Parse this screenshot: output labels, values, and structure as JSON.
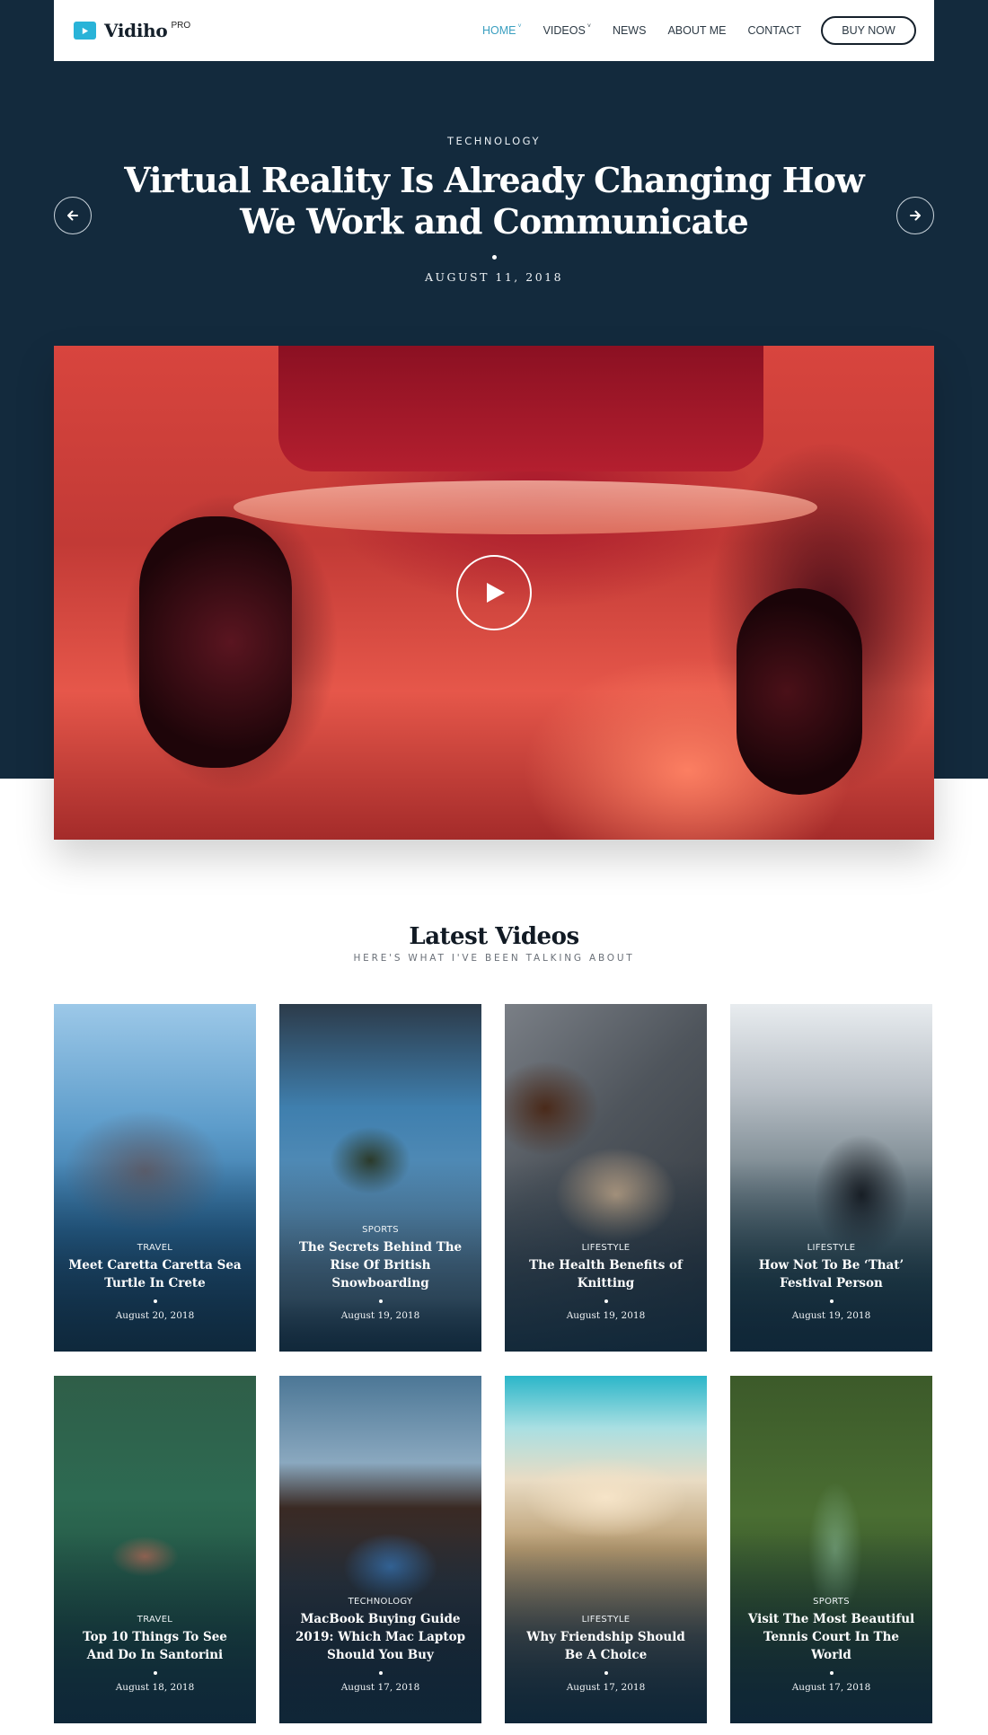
{
  "header": {
    "brand": "Vidiho",
    "brand_badge": "PRO",
    "nav": [
      {
        "label": "HOME",
        "has_dropdown": true,
        "active": true
      },
      {
        "label": "VIDEOS",
        "has_dropdown": true,
        "active": false
      },
      {
        "label": "NEWS",
        "has_dropdown": false,
        "active": false
      },
      {
        "label": "ABOUT ME",
        "has_dropdown": false,
        "active": false
      },
      {
        "label": "CONTACT",
        "has_dropdown": false,
        "active": false
      }
    ],
    "caret": "˅",
    "cta_label": "BUY NOW"
  },
  "hero": {
    "category": "TECHNOLOGY",
    "title": "Virtual Reality Is Already Changing How We Work and Communicate",
    "date": "AUGUST 11, 2018",
    "prev_icon": "arrow-left-icon",
    "next_icon": "arrow-right-icon",
    "media_icon": "play-icon"
  },
  "latest": {
    "title": "Latest Videos",
    "subtitle": "HERE'S WHAT I'VE BEEN TALKING ABOUT",
    "cards": [
      {
        "category": "TRAVEL",
        "title": "Meet Caretta Caretta Sea Turtle In Crete",
        "date": "August 20, 2018"
      },
      {
        "category": "SPORTS",
        "title": "The Secrets Behind The Rise Of British Snowboarding",
        "date": "August 19, 2018"
      },
      {
        "category": "LIFESTYLE",
        "title": "The Health Benefits of Knitting",
        "date": "August 19, 2018"
      },
      {
        "category": "LIFESTYLE",
        "title": "How Not To Be ‘That’ Festival Person",
        "date": "August 19, 2018"
      },
      {
        "category": "TRAVEL",
        "title": "Top 10 Things To See And Do In Santorini",
        "date": "August 18, 2018"
      },
      {
        "category": "TECHNOLOGY",
        "title": "MacBook Buying Guide 2019: Which Mac Laptop Should You Buy",
        "date": "August 17, 2018"
      },
      {
        "category": "LIFESTYLE",
        "title": "Why Friendship Should Be A Choice",
        "date": "August 17, 2018"
      },
      {
        "category": "SPORTS",
        "title": "Visit The Most Beautiful Tennis Court In The World",
        "date": "August 17, 2018"
      }
    ]
  },
  "colors": {
    "accent": "#29b3d8",
    "nav_active": "#3a9fc0",
    "hero_background": "#132a3d"
  }
}
